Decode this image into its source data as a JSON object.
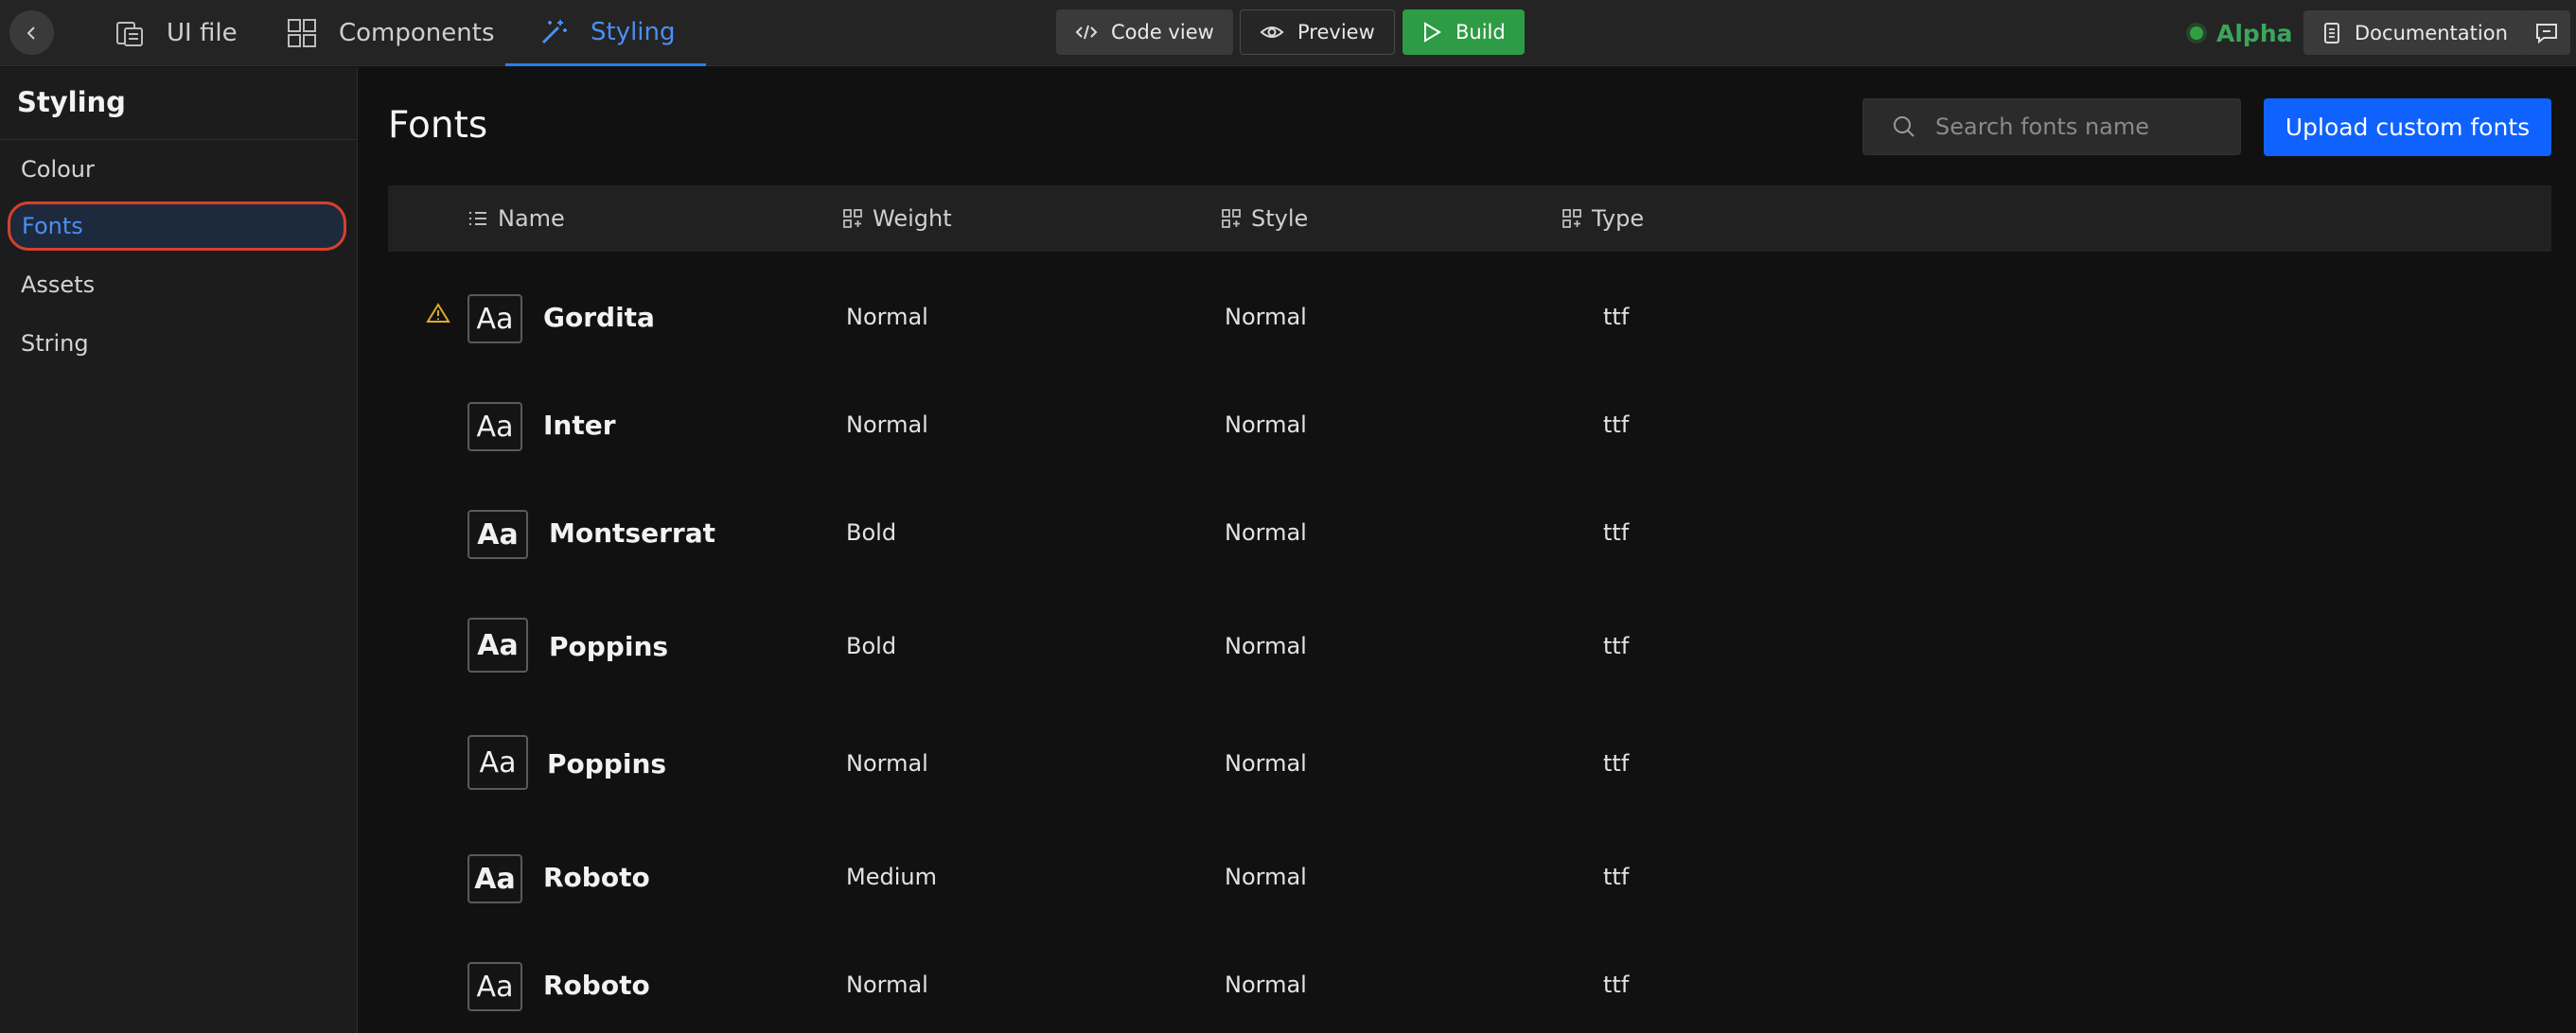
{
  "topbar": {
    "tabs": [
      {
        "label": "UI file",
        "icon": "ui-file-icon"
      },
      {
        "label": "Components",
        "icon": "components-icon"
      },
      {
        "label": "Styling",
        "icon": "magic-wand-icon",
        "active": true
      }
    ],
    "code_view_label": "Code view",
    "preview_label": "Preview",
    "build_label": "Build",
    "status_label": "Alpha",
    "documentation_label": "Documentation"
  },
  "sidebar": {
    "title": "Styling",
    "items": [
      {
        "label": "Colour"
      },
      {
        "label": "Fonts",
        "active": true
      },
      {
        "label": "Assets"
      },
      {
        "label": "String"
      }
    ]
  },
  "main": {
    "title": "Fonts",
    "search_placeholder": "Search fonts name",
    "upload_label": "Upload custom fonts",
    "columns": [
      "Name",
      "Weight",
      "Style",
      "Type"
    ],
    "rows": [
      {
        "name": "Gordita",
        "weight": "Normal",
        "style": "Normal",
        "type": "ttf",
        "warning": true
      },
      {
        "name": "Inter",
        "weight": "Normal",
        "style": "Normal",
        "type": "ttf"
      },
      {
        "name": "Montserrat",
        "weight": "Bold",
        "style": "Normal",
        "type": "ttf"
      },
      {
        "name": "Poppins",
        "weight": "Bold",
        "style": "Normal",
        "type": "ttf"
      },
      {
        "name": "Poppins",
        "weight": "Normal",
        "style": "Normal",
        "type": "ttf"
      },
      {
        "name": "Roboto",
        "weight": "Medium",
        "style": "Normal",
        "type": "ttf"
      },
      {
        "name": "Roboto",
        "weight": "Normal",
        "style": "Normal",
        "type": "ttf"
      }
    ],
    "preview_glyph": "Aa"
  },
  "colors": {
    "accent": "#0f62fe",
    "active_text": "#4a8ff5",
    "build_green": "#2e9b45",
    "status_green": "#3ba55c",
    "highlight_ring": "#d8402c",
    "warning": "#e0a92e"
  }
}
